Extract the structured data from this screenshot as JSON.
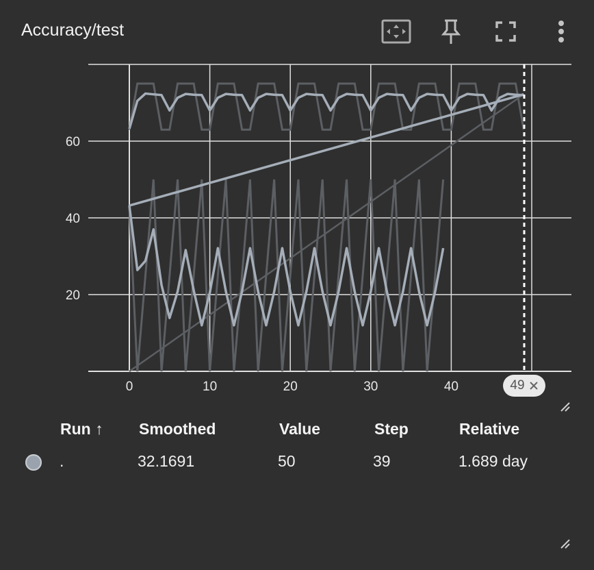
{
  "card": {
    "title": "Accuracy/test"
  },
  "toolbar": {
    "fit_icon": "fit-domain-icon",
    "pin_icon": "pin-icon",
    "fullscreen_icon": "fullscreen-icon",
    "more_icon": "more-vert-icon"
  },
  "chart_data": {
    "type": "line",
    "xlabel": "",
    "ylabel": "",
    "xlim": [
      -5,
      55
    ],
    "ylim": [
      0,
      80
    ],
    "x_ticks": [
      "0",
      "10",
      "20",
      "30",
      "40"
    ],
    "y_ticks": [
      "20",
      "40",
      "60"
    ],
    "grid": true,
    "series": [
      {
        "x": [
          0,
          1,
          2,
          3,
          4,
          5,
          6,
          7,
          8,
          9,
          10,
          11,
          12,
          13,
          14,
          15,
          16,
          17,
          18,
          19,
          20,
          21,
          22,
          23,
          24,
          25,
          26,
          27,
          28,
          29,
          30,
          31,
          32,
          33,
          34,
          35,
          36,
          37,
          38,
          39,
          40,
          41,
          42,
          43,
          44,
          45,
          46,
          47,
          48,
          49
        ],
        "values": [
          63.2,
          70.5,
          72.4,
          72.2,
          72.0,
          68.0,
          71.3,
          72.3,
          72.1,
          72.0,
          68.0,
          71.3,
          72.3,
          72.1,
          72.0,
          68.0,
          71.3,
          72.3,
          72.1,
          72.0,
          68.0,
          71.3,
          72.3,
          72.1,
          72.0,
          68.0,
          71.3,
          72.3,
          72.1,
          72.0,
          68.0,
          71.3,
          72.3,
          72.1,
          72.0,
          68.0,
          71.3,
          72.3,
          72.1,
          72.0,
          68.0,
          71.3,
          72.3,
          72.1,
          72.0,
          68.0,
          71.3,
          72.3,
          72.1,
          72.0
        ]
      },
      {
        "x": [
          0,
          49
        ],
        "values": [
          43.2,
          72.2
        ]
      },
      {
        "x": [
          0,
          1,
          2,
          3,
          4,
          5,
          6,
          7,
          8,
          9,
          10,
          11,
          12,
          13,
          14,
          15,
          16,
          17,
          18,
          19,
          20,
          21,
          22,
          23,
          24,
          25,
          26,
          27,
          28,
          29,
          30,
          31,
          32,
          33,
          34,
          35,
          36,
          37,
          38,
          39
        ],
        "values": [
          43.2,
          26.4,
          28.8,
          37.0,
          22.5,
          13.9,
          20.8,
          31.6,
          21.1,
          12.0,
          20.5,
          32.1,
          20.8,
          12.0,
          20.8,
          32.1,
          20.8,
          12.0,
          20.8,
          32.1,
          20.8,
          12.0,
          20.8,
          32.1,
          20.8,
          12.0,
          20.8,
          32.1,
          20.8,
          12.0,
          20.8,
          32.1,
          20.8,
          12.0,
          20.8,
          32.1,
          20.8,
          12.0,
          20.8,
          32.1
        ]
      }
    ]
  },
  "step_badge": {
    "label": "49",
    "close_icon": "close-icon"
  },
  "table": {
    "headers": {
      "run": "Run ↑",
      "smoothed": "Smoothed",
      "value": "Value",
      "step": "Step",
      "relative": "Relative"
    },
    "rows": [
      {
        "run": ".",
        "smoothed": "32.1691",
        "value": "50",
        "step": "39",
        "relative": "1.689 day",
        "color": "#9aa3ad"
      }
    ]
  },
  "colors": {
    "background": "#2f2f2f",
    "series": "#a5aeb8",
    "raw": "#5c5f63",
    "grid": "#e0e0e0"
  }
}
